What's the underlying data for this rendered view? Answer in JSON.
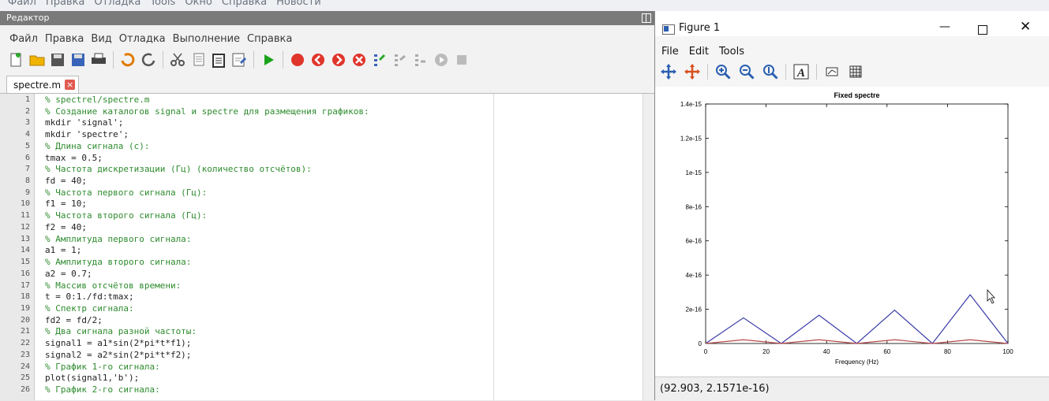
{
  "top_menu": {
    "items": [
      "Файл",
      "Правка",
      "Отладка",
      "Tools",
      "Окно",
      "Справка",
      "Новости"
    ]
  },
  "editor": {
    "title": "Редактор",
    "menu": [
      "Файл",
      "Правка",
      "Вид",
      "Отладка",
      "Выполнение",
      "Справка"
    ],
    "tab": {
      "label": "spectre.m",
      "close_glyph": "×"
    },
    "toolbar_icons": [
      "new-file-icon",
      "open-folder-icon",
      "save-icon",
      "save-as-icon",
      "print-icon",
      "undo-icon",
      "redo-icon",
      "cut-icon",
      "copy-icon",
      "paste-icon",
      "find-icon",
      "run-icon",
      "breakpoint-icon",
      "step-back-icon",
      "step-forward-icon",
      "stop-debug-icon",
      "step-in-icon",
      "step-over-icon",
      "step-out-icon",
      "continue-icon",
      "quit-debug-icon"
    ],
    "lines": [
      {
        "n": "1",
        "t": "% spectrel/spectre.m",
        "c": true
      },
      {
        "n": "2",
        "t": "% Создание каталогов signal и spectre для размещения графиков:",
        "c": true
      },
      {
        "n": "3",
        "t": "mkdir 'signal';",
        "c": false
      },
      {
        "n": "4",
        "t": "mkdir 'spectre';",
        "c": false
      },
      {
        "n": "5",
        "t": "% Длина сигнала (с):",
        "c": true
      },
      {
        "n": "6",
        "t": "tmax = 0.5;",
        "c": false
      },
      {
        "n": "7",
        "t": "% Частота дискретизации (Гц) (количество отсчётов):",
        "c": true
      },
      {
        "n": "8",
        "t": "fd = 40;",
        "c": false
      },
      {
        "n": "9",
        "t": "% Частота первого сигнала (Гц):",
        "c": true
      },
      {
        "n": "10",
        "t": "f1 = 10;",
        "c": false
      },
      {
        "n": "11",
        "t": "% Частота второго сигнала (Гц):",
        "c": true
      },
      {
        "n": "12",
        "t": "f2 = 40;",
        "c": false
      },
      {
        "n": "13",
        "t": "% Амплитуда первого сигнала:",
        "c": true
      },
      {
        "n": "14",
        "t": "a1 = 1;",
        "c": false
      },
      {
        "n": "15",
        "t": "% Амплитуда второго сигнала:",
        "c": true
      },
      {
        "n": "16",
        "t": "a2 = 0.7;",
        "c": false
      },
      {
        "n": "17",
        "t": "% Массив отсчётов времени:",
        "c": true
      },
      {
        "n": "18",
        "t": "t = 0:1./fd:tmax;",
        "c": false
      },
      {
        "n": "19",
        "t": "% Спектр сигнала:",
        "c": true
      },
      {
        "n": "20",
        "t": "fd2 = fd/2;",
        "c": false
      },
      {
        "n": "21",
        "t": "% Два сигнала разной частоты:",
        "c": true
      },
      {
        "n": "22",
        "t": "signal1 = a1*sin(2*pi*t*f1);",
        "c": false
      },
      {
        "n": "23",
        "t": "signal2 = a2*sin(2*pi*t*f2);",
        "c": false
      },
      {
        "n": "24",
        "t": "% График 1-го сигнала:",
        "c": true
      },
      {
        "n": "25",
        "t": "plot(signal1,'b');",
        "c": false
      },
      {
        "n": "26",
        "t": "% График 2-го сигнала:",
        "c": true
      }
    ]
  },
  "figure": {
    "title": "Figure 1",
    "window_controls": {
      "minimize": "—",
      "close": "✕"
    },
    "menu": [
      "File",
      "Edit",
      "Tools"
    ],
    "toolbar_icons": [
      "pan-icon",
      "rotate-icon",
      "zoom-in-icon",
      "zoom-out-icon",
      "auto-axis-icon",
      "text-icon",
      "axes-icon",
      "grid-icon"
    ],
    "status": "(92.903, 2.1571e-16)"
  },
  "colors": {
    "blue_series": "#3a3aa8",
    "red_series": "#b84a4a",
    "comment": "#2e8b2e",
    "string": "#b0307a"
  },
  "chart_data": {
    "type": "line",
    "title": "Fixed spectre",
    "xlabel": "Frequency (Hz)",
    "ylabel": "",
    "xlim": [
      0,
      100
    ],
    "ylim": [
      0,
      1.4e-15
    ],
    "x_ticks": [
      0,
      20,
      40,
      60,
      80,
      100
    ],
    "x_tick_labels": [
      "0",
      "20",
      "40",
      "60",
      "80",
      "100"
    ],
    "y_ticks": [
      0,
      2e-16,
      4e-16,
      6e-16,
      8e-16,
      1e-15,
      1.2e-15,
      1.4e-15
    ],
    "y_tick_labels": [
      "0",
      "2e-16",
      "4e-16",
      "6e-16",
      "8e-16",
      "1e-15",
      "1.2e-15",
      "1.4e-15"
    ],
    "grid": false,
    "series": [
      {
        "color": "#3a3aa8",
        "x": [
          0,
          12.5,
          25,
          37.5,
          50,
          62.5,
          75,
          87.5,
          100
        ],
        "values": [
          0,
          1.5e-16,
          0,
          1.65e-16,
          0,
          1.95e-16,
          0,
          2.85e-16,
          0
        ]
      },
      {
        "color": "#b84a4a",
        "x": [
          0,
          12.5,
          25,
          37.5,
          50,
          62.5,
          75,
          87.5,
          100
        ],
        "values": [
          0,
          2.2e-17,
          0,
          2.2e-17,
          0,
          2.2e-17,
          0,
          2.2e-17,
          0
        ]
      }
    ]
  }
}
